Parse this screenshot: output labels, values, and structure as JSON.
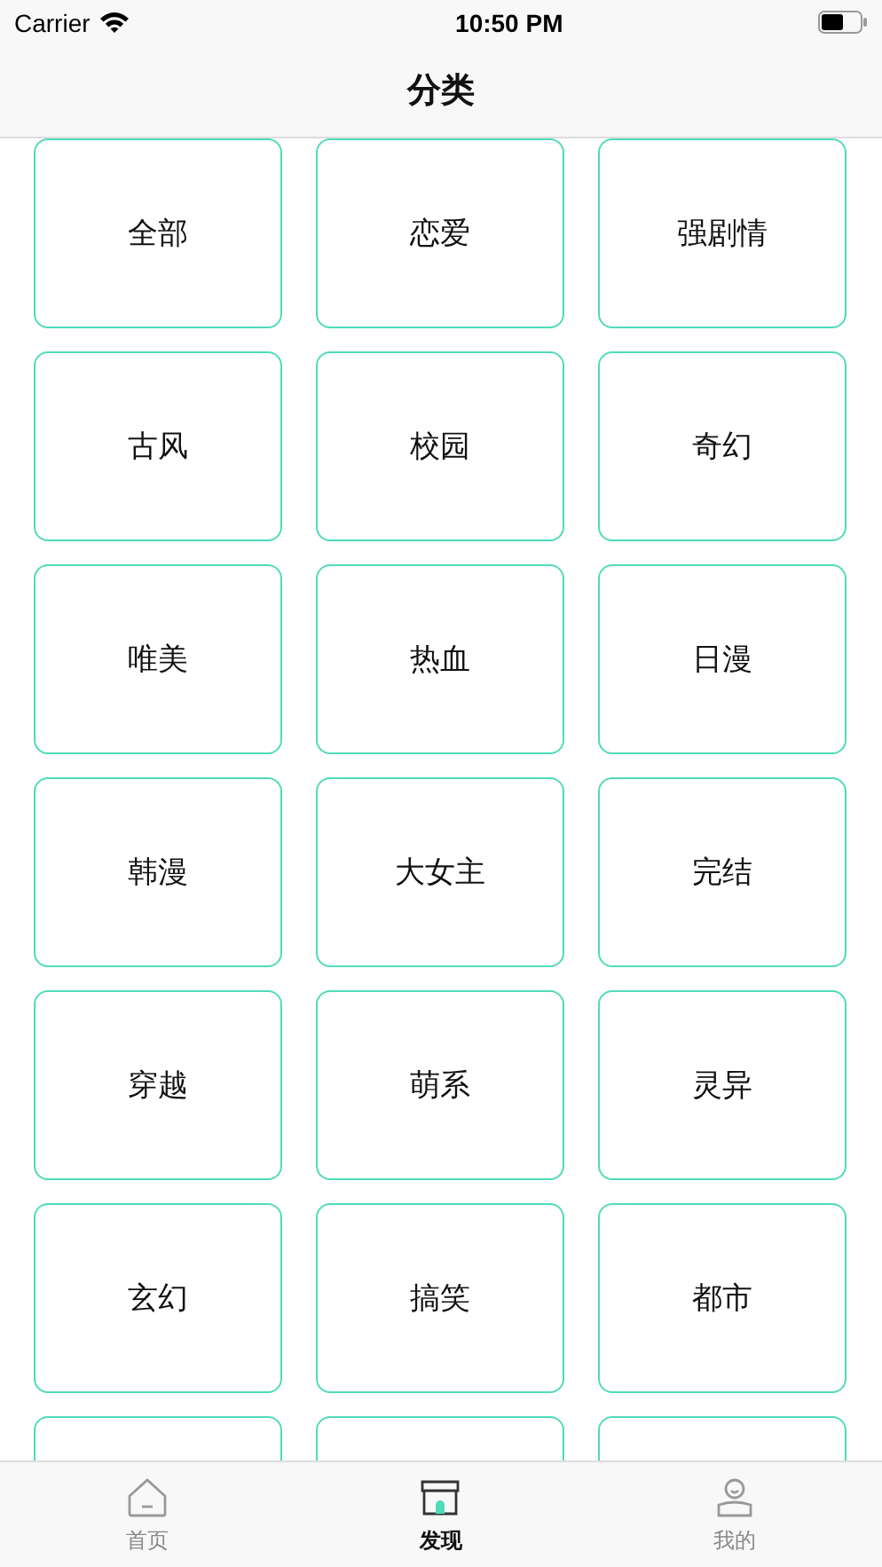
{
  "status_bar": {
    "carrier": "Carrier",
    "time": "10:50 PM"
  },
  "nav_bar": {
    "title": "分类"
  },
  "categories": [
    {
      "kind": "full",
      "label": "全部"
    },
    {
      "kind": "full",
      "label": "恋爱"
    },
    {
      "kind": "full",
      "label": "强剧情"
    },
    {
      "kind": "full",
      "label": "古风"
    },
    {
      "kind": "full",
      "label": "校园"
    },
    {
      "kind": "full",
      "label": "奇幻"
    },
    {
      "kind": "full",
      "label": "唯美"
    },
    {
      "kind": "full",
      "label": "热血"
    },
    {
      "kind": "full",
      "label": "日漫"
    },
    {
      "kind": "full",
      "label": "韩漫"
    },
    {
      "kind": "full",
      "label": "大女主"
    },
    {
      "kind": "full",
      "label": "完结"
    },
    {
      "kind": "full",
      "label": "穿越"
    },
    {
      "kind": "full",
      "label": "萌系"
    },
    {
      "kind": "full",
      "label": "灵异"
    },
    {
      "kind": "full",
      "label": "玄幻"
    },
    {
      "kind": "full",
      "label": "搞笑"
    },
    {
      "kind": "full",
      "label": "都市"
    },
    {
      "kind": "partial"
    },
    {
      "kind": "partial"
    },
    {
      "kind": "partial"
    }
  ],
  "tab_bar": [
    {
      "kind": "home",
      "label": "首页",
      "selected": false
    },
    {
      "kind": "shop",
      "label": "发现",
      "selected": true
    },
    {
      "kind": "profile",
      "label": "我的",
      "selected": false
    }
  ]
}
